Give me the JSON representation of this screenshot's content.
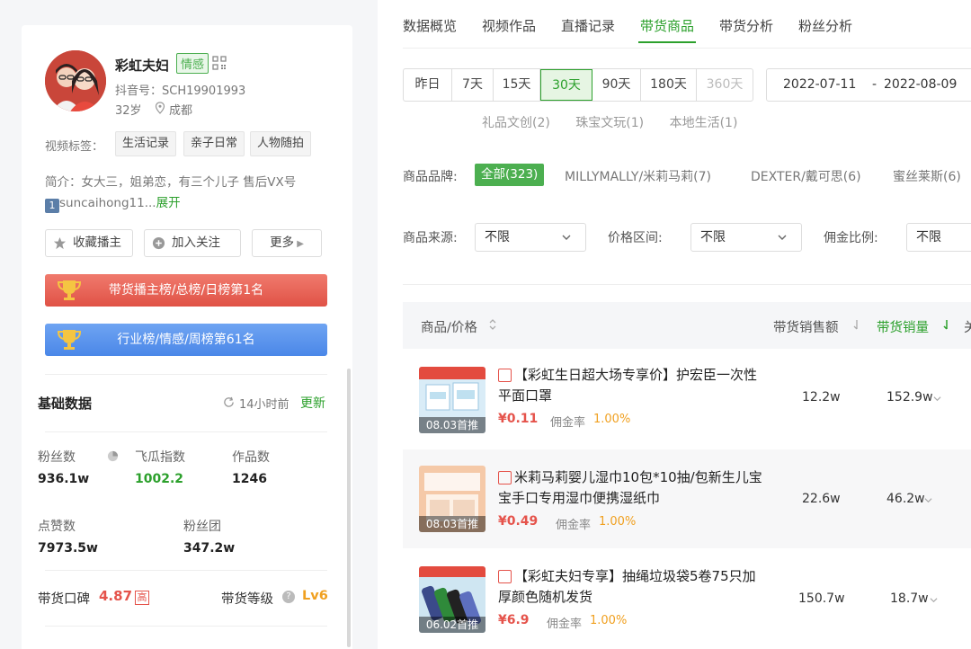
{
  "profile": {
    "name": "彩虹夫妇",
    "category_tag": "情感",
    "douyin_id": "抖音号：SCH19901993",
    "age": "32岁",
    "city": "成都",
    "video_tags_label": "视频标签：",
    "video_tags": [
      "生活记录",
      "亲子日常",
      "人物随拍"
    ],
    "intro_text": "简介：女大三，姐弟恋，有三个儿子 售后VX号",
    "intro_num": "1",
    "intro_tail": "suncaihong11...",
    "intro_expand": "展开",
    "buttons": {
      "favorite": "收藏播主",
      "follow": "加入关注",
      "more": "更多"
    },
    "rank_red": "带货播主榜/总榜/日榜第1名",
    "rank_blue": "行业榜/情感/周榜第61名"
  },
  "basic": {
    "title": "基础数据",
    "refresh_time": "14小时前",
    "refresh_btn": "更新",
    "stats": [
      {
        "label": "粉丝数",
        "value": "936.1w"
      },
      {
        "label": "飞瓜指数",
        "value": "1002.2"
      },
      {
        "label": "作品数",
        "value": "1246"
      },
      {
        "label": "点赞数",
        "value": "7973.5w"
      },
      {
        "label": "粉丝团",
        "value": "347.2w"
      }
    ],
    "reputation_label": "带货口碑",
    "reputation_score": "4.87",
    "reputation_badge": "高",
    "level_label": "带货等级",
    "level_value": "Lv6"
  },
  "tabs": [
    "数据概览",
    "视频作品",
    "直播记录",
    "带货商品",
    "带货分析",
    "粉丝分析"
  ],
  "active_tab": "带货商品",
  "ranges": [
    "昨日",
    "7天",
    "15天",
    "30天",
    "90天",
    "180天",
    "360天"
  ],
  "active_range": "30天",
  "date_start": "2022-07-11",
  "date_sep": "-",
  "date_end": "2022-08-09",
  "cut_categories": [
    "礼品文创(2)",
    "珠宝文玩(1)",
    "本地生活(1)"
  ],
  "brand_label": "商品品牌:",
  "brands": [
    "全部(323)",
    "MILLYMALLY/米莉马莉(7)",
    "DEXTER/戴可思(6)",
    "蜜丝莱斯(6)"
  ],
  "filters": {
    "source_label": "商品来源:",
    "source_value": "不限",
    "price_label": "价格区间:",
    "price_value": "不限",
    "comm_label": "佣金比例:",
    "comm_value": "不限"
  },
  "table": {
    "col_product": "商品/价格",
    "col_sales_amount": "带货销售额",
    "col_sales_volume": "带货销量",
    "col_cut": "关"
  },
  "products": [
    {
      "title": "【彩虹生日超大场专享价】护宏臣一次性平面口罩",
      "badge": "08.03首推",
      "price": "¥0.11",
      "comm_label": "佣金率",
      "comm": "1.00%",
      "sales_amount": "12.2w",
      "sales_volume": "152.9w"
    },
    {
      "title": "米莉马莉婴儿湿巾10包*10抽/包新生儿宝宝手口专用湿巾便携湿纸巾",
      "badge": "08.03首推",
      "price": "¥0.49",
      "comm_label": "佣金率",
      "comm": "1.00%",
      "sales_amount": "22.6w",
      "sales_volume": "46.2w"
    },
    {
      "title": "【彩虹夫妇专享】抽绳垃圾袋5卷75只加厚颜色随机发货",
      "badge": "06.02首推",
      "price": "¥6.9",
      "comm_label": "佣金率",
      "comm": "1.00%",
      "sales_amount": "150.7w",
      "sales_volume": "18.7w"
    }
  ],
  "colors": {
    "accent_green": "#2ca02c",
    "price_red": "#e5534b",
    "orange": "#f0a020"
  }
}
